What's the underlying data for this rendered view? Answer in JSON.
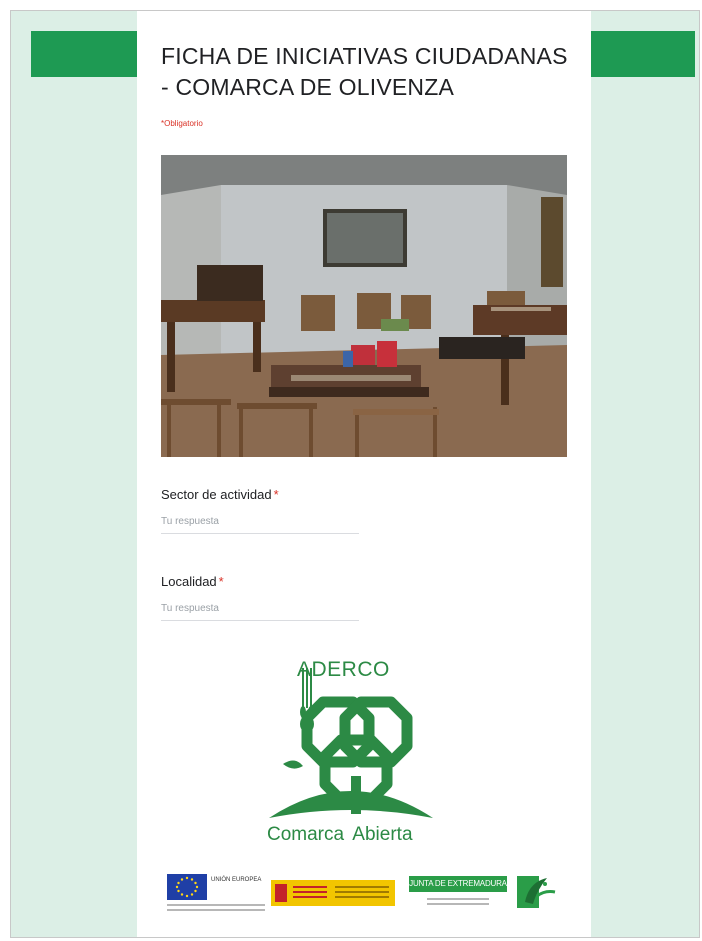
{
  "form": {
    "title": "FICHA DE INICIATIVAS CIUDADANAS - COMARCA DE OLIVENZA",
    "required_note": "*Obligatorio",
    "header_image": "classroom-photo",
    "questions": [
      {
        "label": "Sector de actividad",
        "required_mark": "*",
        "placeholder": "Tu respuesta",
        "value": ""
      },
      {
        "label": "Localidad",
        "required_mark": "*",
        "placeholder": "Tu respuesta",
        "value": ""
      }
    ]
  },
  "logo": {
    "name": "ADERCO",
    "tagline": "Comarca Abierta",
    "color": "#2c8a45"
  },
  "sponsors": {
    "eu_label": "UNIÓN EUROPEA",
    "junta_label": "JUNTA DE EXTREMADURA"
  },
  "colors": {
    "accent": "#1e9a53",
    "background": "#dcefe6",
    "required": "#d93025"
  }
}
